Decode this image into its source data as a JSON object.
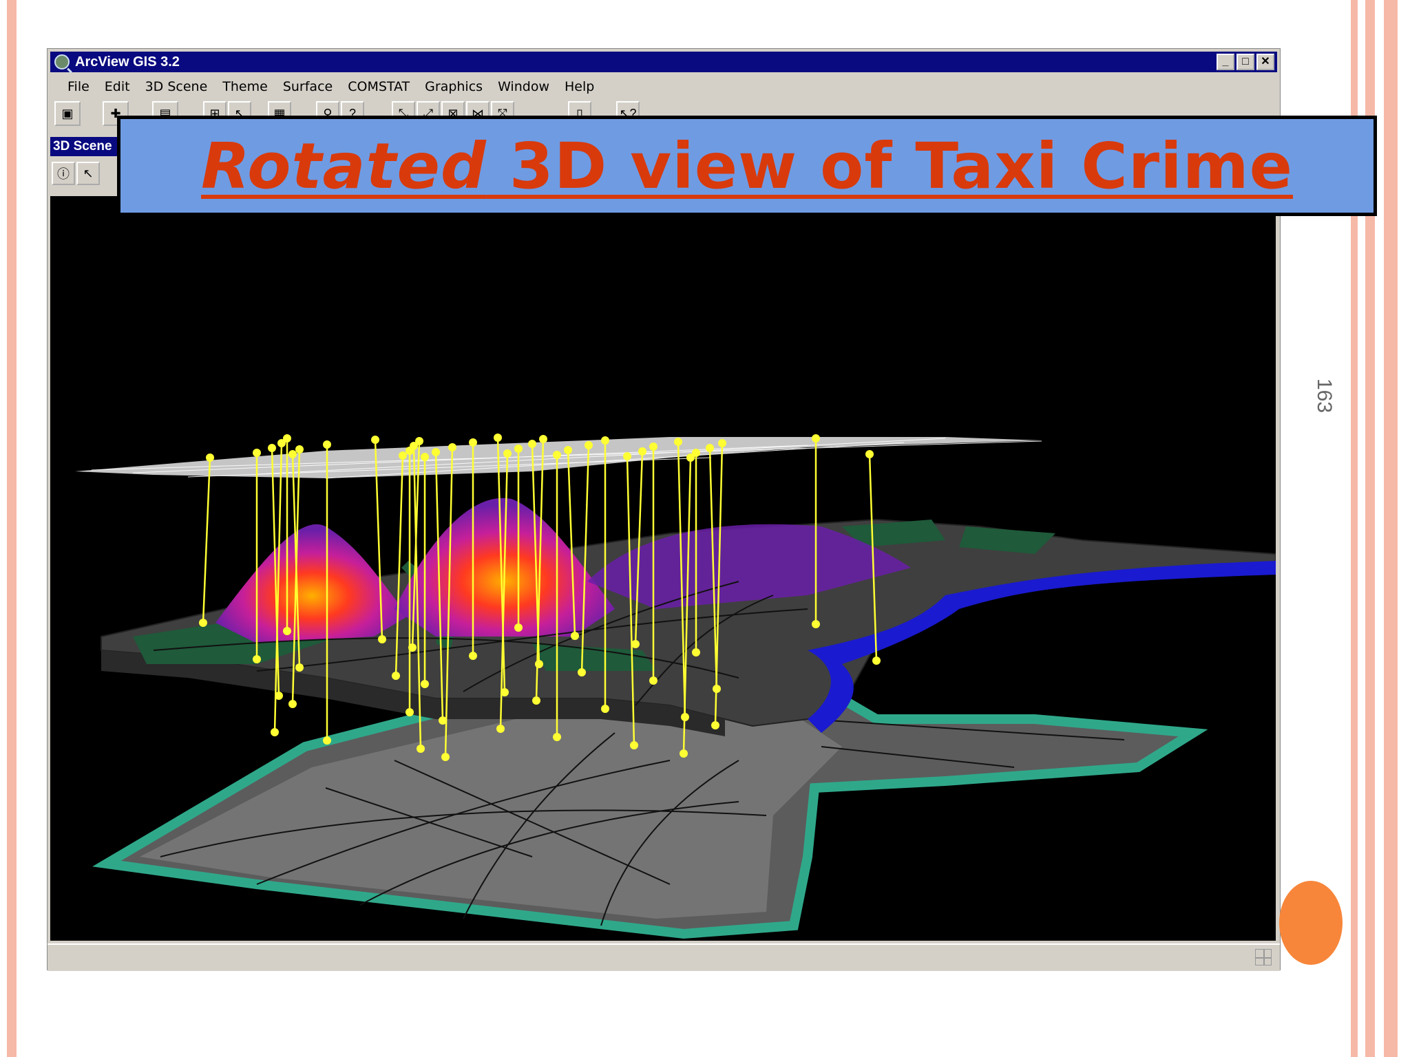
{
  "slide": {
    "title_emphasis": "Rotated",
    "title_rest": " 3D view of Taxi Crime",
    "page_number": "163",
    "colors": {
      "border": "#f6b9a8",
      "accent_dot": "#f7863a",
      "banner_bg": "#6f9be3",
      "banner_text": "#d83a0c"
    }
  },
  "window": {
    "title": "ArcView GIS 3.2",
    "controls": {
      "minimize": "_",
      "maximize": "□",
      "close": "✕"
    },
    "menu": [
      "File",
      "Edit",
      "3D Scene",
      "Theme",
      "Surface",
      "COMSTAT",
      "Graphics",
      "Window",
      "Help"
    ],
    "toolbar_icons": [
      "save-icon",
      "add-theme-icon",
      "print-icon",
      "theme-properties-icon",
      "edit-legend-icon",
      "table-icon",
      "find-icon",
      "query-icon",
      "zoom-in-icon",
      "zoom-out-icon",
      "zoom-full-icon",
      "zoom-selected-icon",
      "zoom-extent-icon",
      "layout-icon",
      "help-icon"
    ],
    "subwindow_title": "3D Scene",
    "subtools": [
      "info-icon",
      "select-pointer-icon"
    ]
  },
  "scene": {
    "layers": [
      "crime points layer (white)",
      "density surface layer",
      "aerial imagery base layer"
    ],
    "colors": {
      "background": "#000000",
      "points": "#ffff00",
      "surface_low": "#6a1fa8",
      "surface_high": "#ffb000",
      "water": "#1a1ad0",
      "parks": "#1f5a3a",
      "land": "#4a4a4a"
    }
  }
}
